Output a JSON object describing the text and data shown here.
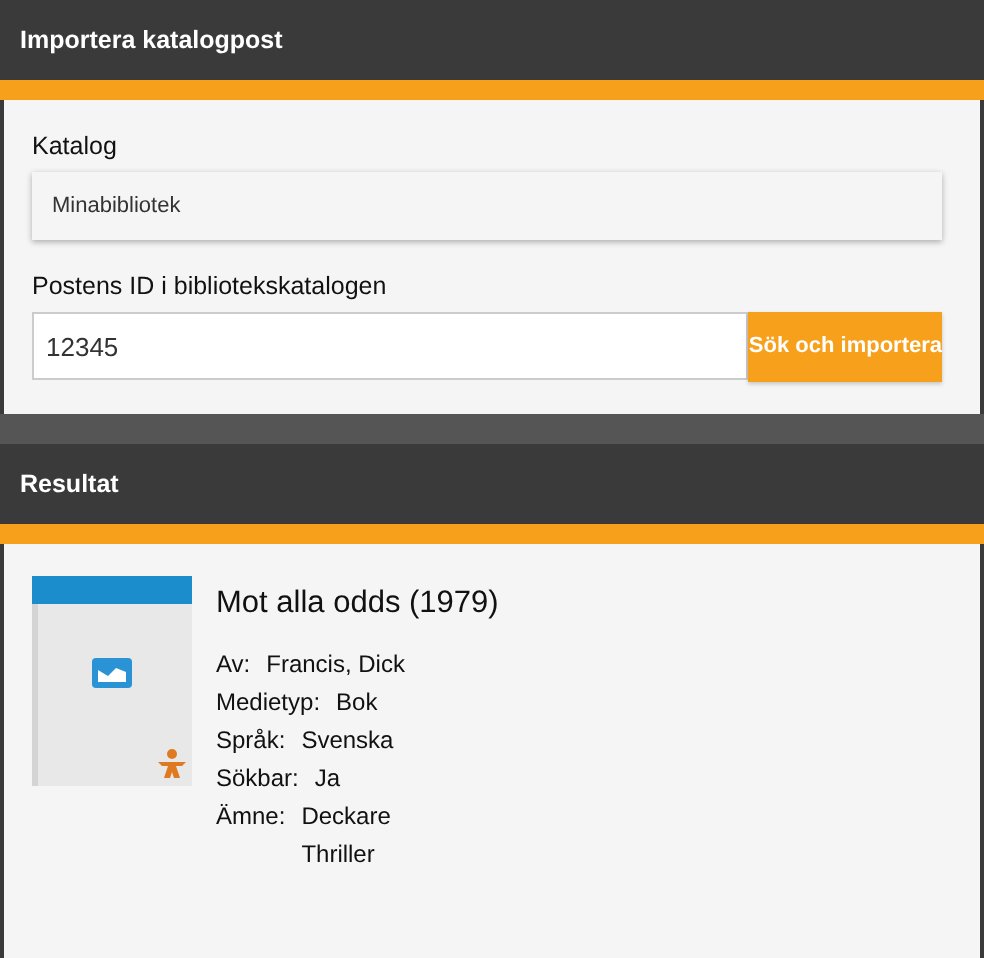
{
  "import_panel": {
    "title": "Importera katalogpost",
    "catalog": {
      "label": "Katalog",
      "value": "Minabibliotek"
    },
    "record_id": {
      "label": "Postens ID i bibliotekskatalogen",
      "value": "12345"
    },
    "button": "Sök och importera"
  },
  "result_panel": {
    "title": "Resultat",
    "item": {
      "title": "Mot alla odds (1979)",
      "details": [
        {
          "label": "Av:",
          "values": [
            "Francis, Dick"
          ]
        },
        {
          "label": "Medietyp:",
          "values": [
            "Bok"
          ]
        },
        {
          "label": "Språk:",
          "values": [
            "Svenska"
          ]
        },
        {
          "label": "Sökbar:",
          "values": [
            "Ja"
          ]
        },
        {
          "label": "Ämne:",
          "values": [
            "Deckare",
            "Thriller"
          ]
        }
      ]
    }
  }
}
